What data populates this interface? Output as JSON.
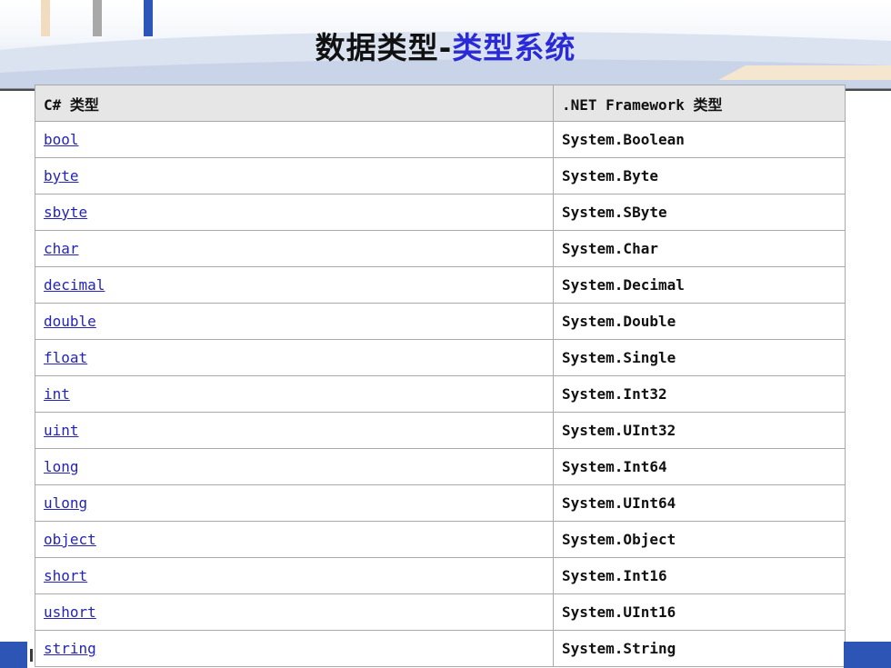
{
  "slide": {
    "title_main": "数据类型-",
    "title_accent": "类型系统"
  },
  "table": {
    "headers": [
      "C# 类型",
      ".NET Framework 类型"
    ],
    "rows": [
      {
        "cs": "bool",
        "net": "System.Boolean"
      },
      {
        "cs": "byte",
        "net": "System.Byte"
      },
      {
        "cs": "sbyte",
        "net": "System.SByte"
      },
      {
        "cs": "char",
        "net": "System.Char"
      },
      {
        "cs": "decimal",
        "net": "System.Decimal"
      },
      {
        "cs": "double",
        "net": "System.Double"
      },
      {
        "cs": "float",
        "net": "System.Single"
      },
      {
        "cs": "int",
        "net": "System.Int32"
      },
      {
        "cs": "uint",
        "net": "System.UInt32"
      },
      {
        "cs": "long",
        "net": "System.Int64"
      },
      {
        "cs": "ulong",
        "net": "System.UInt64"
      },
      {
        "cs": "object",
        "net": "System.Object"
      },
      {
        "cs": "short",
        "net": "System.Int16"
      },
      {
        "cs": "ushort",
        "net": "System.UInt16"
      },
      {
        "cs": "string",
        "net": "System.String"
      }
    ]
  },
  "colors": {
    "title_accent": "#2a2ad6",
    "link": "#2424b8",
    "header_bg": "#e6e6e6",
    "brand_blue": "#2d55b6"
  }
}
